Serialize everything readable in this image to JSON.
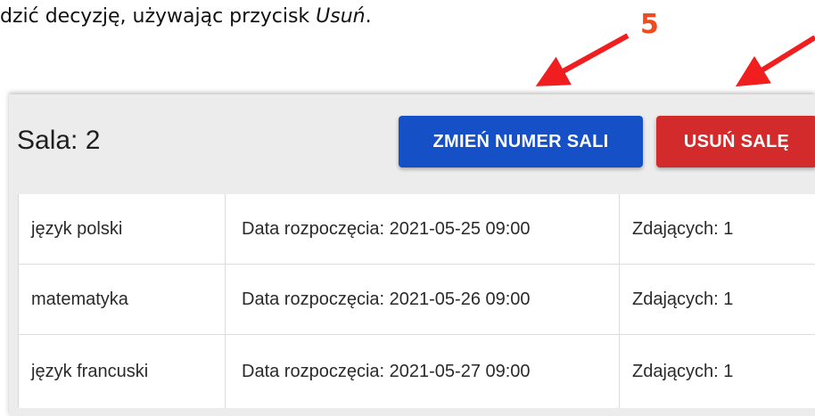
{
  "instruction": {
    "text_before": "dzić decyzję, używając przycisk ",
    "button_name": "Usuń",
    "text_after": "."
  },
  "annotation": {
    "step_number": "5",
    "arrow_color": "#f01e1e"
  },
  "room": {
    "title": "Sala: 2",
    "change_number_button": "ZMIEŃ NUMER SALI",
    "delete_button": "USUŃ SALĘ"
  },
  "exams": [
    {
      "subject": "język polski",
      "start": "Data rozpoczęcia: 2021-05-25 09:00",
      "count": "Zdających: 1"
    },
    {
      "subject": "matematyka",
      "start": "Data rozpoczęcia: 2021-05-26 09:00",
      "count": "Zdających: 1"
    },
    {
      "subject": "język francuski",
      "start": "Data rozpoczęcia: 2021-05-27 09:00",
      "count": "Zdających: 1"
    }
  ],
  "colors": {
    "primary_button": "#1650c7",
    "danger_button": "#d32b2b",
    "panel_background": "#ececec"
  }
}
